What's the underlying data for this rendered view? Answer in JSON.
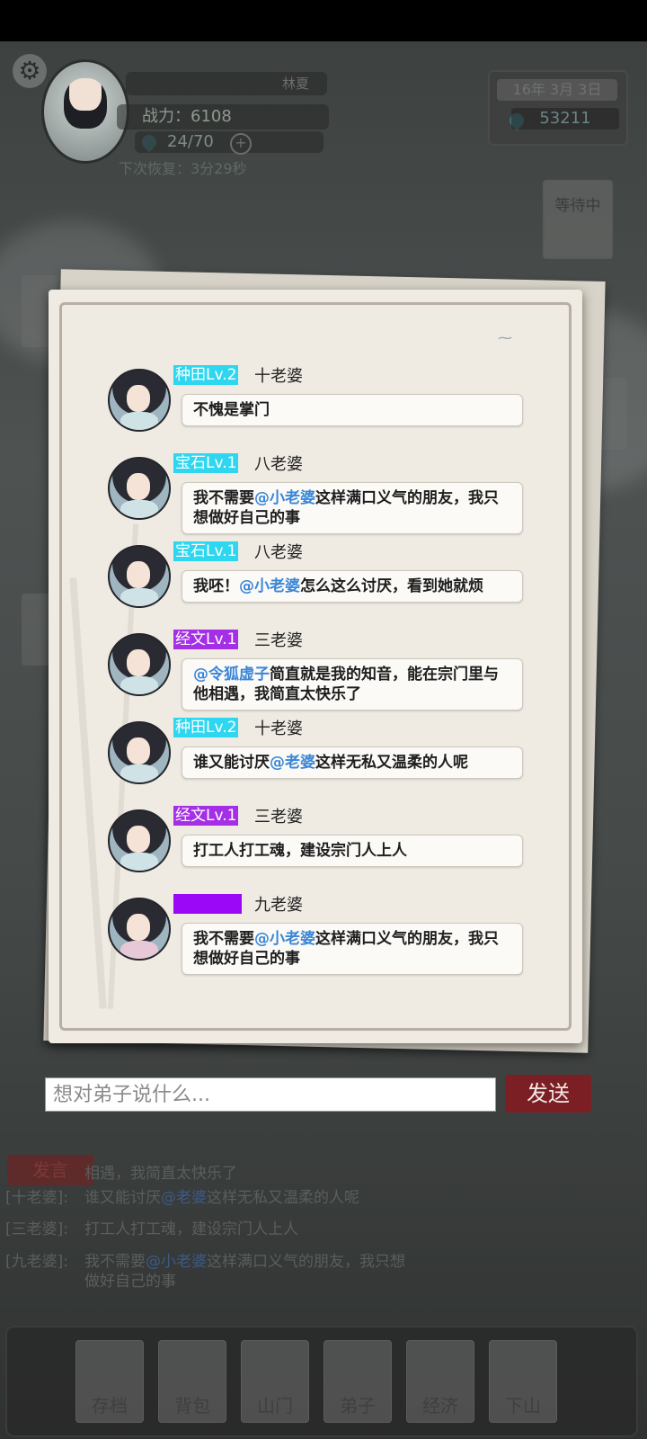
{
  "header": {
    "player_name": "林夏",
    "power": "战力：6108",
    "stamina": "24/70",
    "recover": "下次恢复：3分29秒",
    "date": "16年   3月   3日",
    "money": "53211",
    "waiting": "等待中"
  },
  "chat": {
    "messages": [
      {
        "tag": "种田Lv.2",
        "tag_color": "#2fd6f0",
        "name": "十老婆",
        "parts": [
          {
            "t": "不愧是掌门"
          }
        ]
      },
      {
        "tag": "宝石Lv.1",
        "tag_color": "#2fd6f0",
        "name": "八老婆",
        "parts": [
          {
            "t": "我不需要"
          },
          {
            "t": "@小老婆",
            "m": true
          },
          {
            "t": "这样满口义气的朋友，我只想做好自己的事"
          }
        ]
      },
      {
        "tag": "宝石Lv.1",
        "tag_color": "#2fd6f0",
        "name": "八老婆",
        "parts": [
          {
            "t": "我呸！"
          },
          {
            "t": "@小老婆",
            "m": true
          },
          {
            "t": "怎么这么讨厌，看到她就烦"
          }
        ]
      },
      {
        "tag": "经文Lv.1",
        "tag_color": "#a52fe6",
        "name": "三老婆",
        "parts": [
          {
            "t": "@令狐虚子",
            "m": true
          },
          {
            "t": "简直就是我的知音，能在宗门里与他相遇，我简直太快乐了"
          }
        ]
      },
      {
        "tag": "种田Lv.2",
        "tag_color": "#2fd6f0",
        "name": "十老婆",
        "parts": [
          {
            "t": "谁又能讨厌"
          },
          {
            "t": "@老婆",
            "m": true
          },
          {
            "t": "这样无私又温柔的人呢"
          }
        ]
      },
      {
        "tag": "经文Lv.1",
        "tag_color": "#a52fe6",
        "name": "三老婆",
        "parts": [
          {
            "t": "打工人打工魂，建设宗门人上人"
          }
        ]
      },
      {
        "tag": "",
        "tag_color": "#9b08f7",
        "name": "九老婆",
        "parts": [
          {
            "t": "我不需要"
          },
          {
            "t": "@小老婆",
            "m": true
          },
          {
            "t": "这样满口义气的朋友，我只想做好自己的事"
          }
        ]
      }
    ]
  },
  "input": {
    "placeholder": "想对弟子说什么...",
    "send_label": "发送"
  },
  "log": {
    "speak_label": "发言",
    "lines": [
      {
        "who": "",
        "parts": [
          {
            "t": "相遇，我简直太快乐了"
          }
        ]
      },
      {
        "who": "[十老婆]:",
        "parts": [
          {
            "t": "谁又能讨厌"
          },
          {
            "t": "@老婆",
            "m": true
          },
          {
            "t": "这样无私又温柔的人呢"
          }
        ]
      },
      {
        "who": "[三老婆]:",
        "parts": [
          {
            "t": "打工人打工魂，建设宗门人上人"
          }
        ]
      },
      {
        "who": "[九老婆]:",
        "parts": [
          {
            "t": "我不需要"
          },
          {
            "t": "@小老婆",
            "m": true
          },
          {
            "t": "这样满口义气的朋友，我只想"
          }
        ]
      },
      {
        "who": "",
        "parts": [
          {
            "t": "做好自己的事"
          }
        ]
      }
    ]
  },
  "dock": {
    "buttons": [
      "存档",
      "背包",
      "山门",
      "弟子",
      "经济",
      "下山"
    ]
  }
}
